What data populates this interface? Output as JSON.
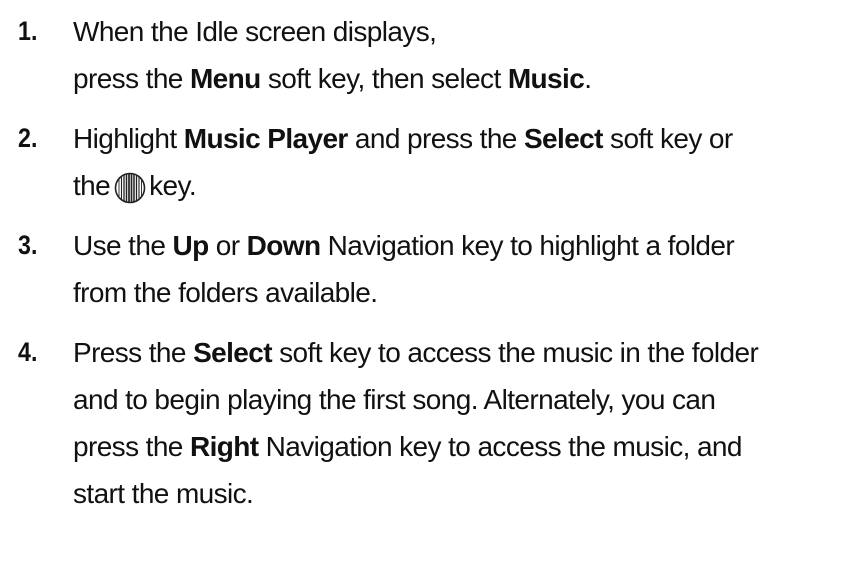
{
  "steps": [
    {
      "number": "1.",
      "lines": [
        {
          "t1": "When the Idle screen displays,"
        },
        {
          "t1": "press the ",
          "b1": "Menu",
          "t2": " soft key, then select ",
          "b2": "Music",
          "t3": "."
        }
      ]
    },
    {
      "number": "2.",
      "lines": [
        {
          "t1": "Highlight ",
          "b1": "Music Player",
          "t2": " and press the ",
          "b2": "Select",
          "t3": " soft key or"
        },
        {
          "t1": "the",
          "icon": "center-select-key-icon",
          "t2": "key."
        }
      ]
    },
    {
      "number": "3.",
      "lines": [
        {
          "t1": "Use the ",
          "b1": "Up",
          "t2": " or ",
          "b2": "Down",
          "t3": " Navigation key to highlight a folder"
        },
        {
          "t1": "from the folders available."
        }
      ]
    },
    {
      "number": "4.",
      "lines": [
        {
          "t1": "Press the ",
          "b1": "Select",
          "t2": " soft key to access the music in the folder"
        },
        {
          "t1": "and to begin playing the first song. Alternately, you can"
        },
        {
          "t1": "press the ",
          "b1": "Right",
          "t2": " Navigation key to access the music, and"
        },
        {
          "t1": "start the music."
        }
      ]
    }
  ]
}
